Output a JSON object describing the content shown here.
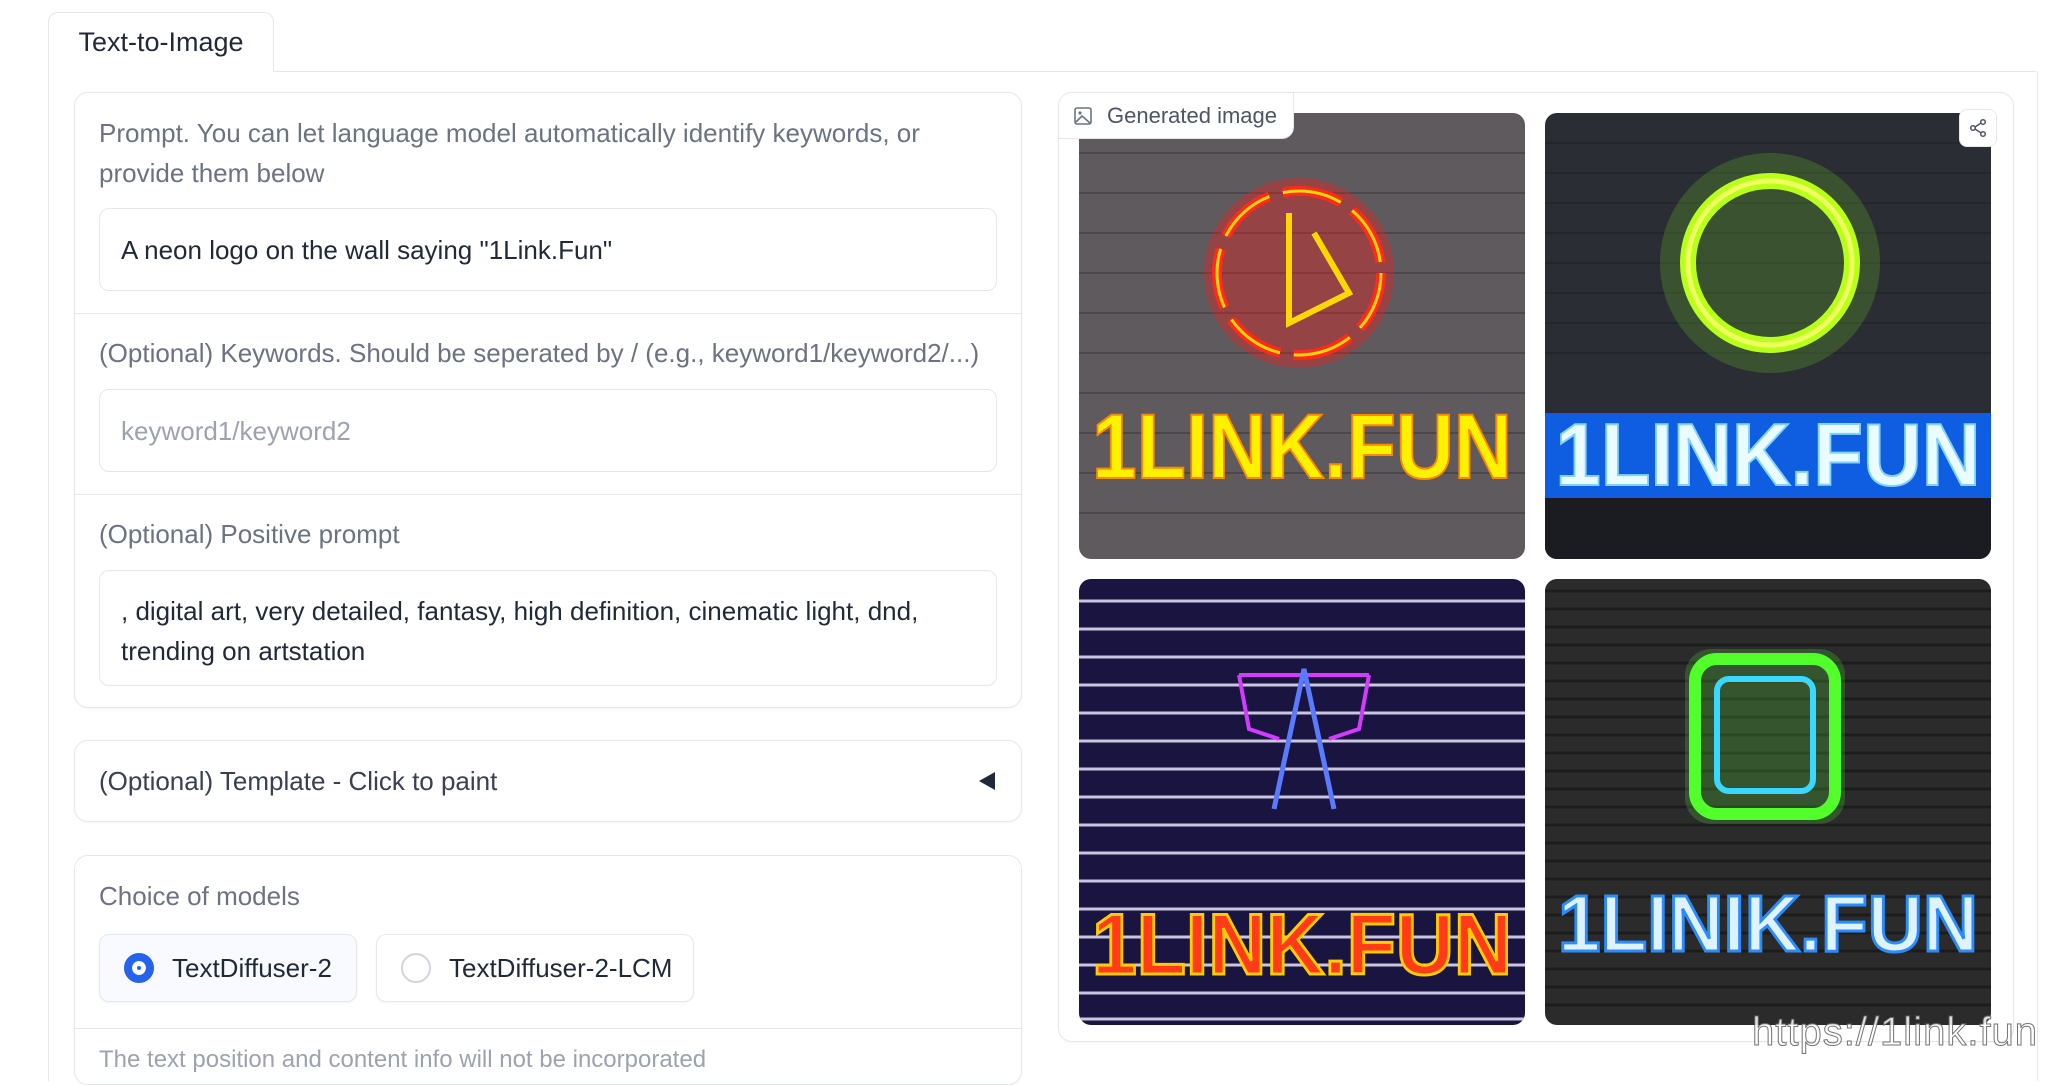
{
  "tabs": {
    "active": "Text-to-Image"
  },
  "prompt": {
    "label": "Prompt. You can let language model automatically identify keywords, or provide them below",
    "value": "A neon logo on the wall saying \"1Link.Fun\""
  },
  "keywords": {
    "label": "(Optional) Keywords. Should be seperated by / (e.g., keyword1/keyword2/...)",
    "placeholder": "keyword1/keyword2"
  },
  "positive": {
    "label": "(Optional) Positive prompt",
    "value": ", digital art, very detailed, fantasy, high definition, cinematic light, dnd, trending on artstation"
  },
  "template": {
    "label": "(Optional) Template - Click to paint",
    "toggle_icon": "triangle-left-icon"
  },
  "models": {
    "label": "Choice of models",
    "options": [
      "TextDiffuser-2",
      "TextDiffuser-2-LCM"
    ],
    "selected": "TextDiffuser-2"
  },
  "info_text": "The text position and content info will not be incorporated",
  "gallery": {
    "label": "Generated image",
    "images": [
      {
        "text": "1LINK.FUN",
        "text_color": "#ffef00",
        "glow_color": "#ff1a1a",
        "bg": "#5f5a5e",
        "icon": "red-neon-clock-logo"
      },
      {
        "text": "1LINK.FUN",
        "text_color": "#e8fbff",
        "glow_color": "#1e7bff",
        "bg": "#2a2d33",
        "icon": "green-neon-ring-logo"
      },
      {
        "text": "1LINK.FUN",
        "text_color": "#ff3b1a",
        "glow_color": "#ffb000",
        "bg": "#1a1440",
        "icon": "purple-neon-tower-logo"
      },
      {
        "text": "1LINIK.FUN",
        "text_color": "#cfeaff",
        "glow_color": "#1e6bff",
        "bg": "#2b2b2b",
        "icon": "green-neon-square-logo"
      }
    ]
  },
  "watermark": "https://1link.fun",
  "colors": {
    "accent": "#2563eb",
    "border": "#e5e7eb",
    "label": "#6b7280"
  }
}
